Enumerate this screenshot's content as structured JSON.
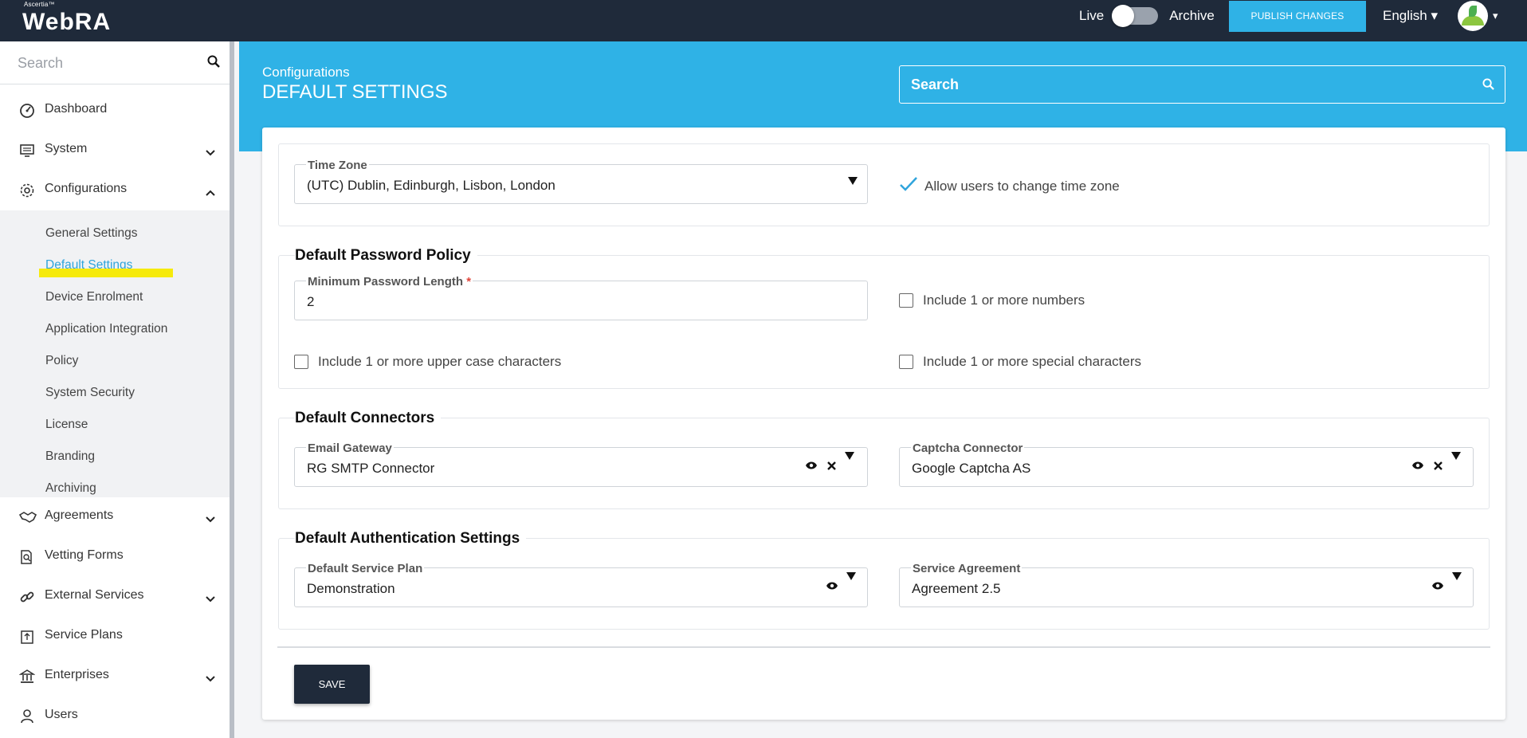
{
  "topbar": {
    "brand_small": "Ascertia™",
    "brand_name": "WebRA",
    "live_label": "Live",
    "archive_label": "Archive",
    "publish_label": "PUBLISH CHANGES",
    "language": "English ▾",
    "avatar_caret": "▾",
    "colors": {
      "bar": "#1f2a3a",
      "accent": "#2fb2e6"
    }
  },
  "sidebar": {
    "search_placeholder": "Search",
    "items": [
      {
        "label": "Dashboard",
        "icon": "dashboard-icon"
      },
      {
        "label": "System",
        "icon": "monitor-icon"
      },
      {
        "label": "Configurations",
        "icon": "gear-icon"
      },
      {
        "label": "Agreements",
        "icon": "handshake-icon"
      },
      {
        "label": "Vetting Forms",
        "icon": "form-search-icon"
      },
      {
        "label": "External Services",
        "icon": "link-icon"
      },
      {
        "label": "Service Plans",
        "icon": "plan-icon"
      },
      {
        "label": "Enterprises",
        "icon": "bank-icon"
      },
      {
        "label": "Users",
        "icon": "user-icon"
      }
    ],
    "subitems": [
      {
        "label": "General Settings"
      },
      {
        "label": "Default Settings"
      },
      {
        "label": "Device Enrolment"
      },
      {
        "label": "Application Integration"
      },
      {
        "label": "Policy"
      },
      {
        "label": "System Security"
      },
      {
        "label": "License"
      },
      {
        "label": "Branding"
      },
      {
        "label": "Archiving"
      }
    ]
  },
  "header": {
    "breadcrumb": "Configurations",
    "title": "DEFAULT SETTINGS",
    "search_placeholder": "Search"
  },
  "timezone": {
    "label": "Time Zone",
    "value": "(UTC) Dublin, Edinburgh, Lisbon, London",
    "allow_change_label": "Allow users to change time zone",
    "allow_change_checked": true
  },
  "password_policy": {
    "title": "Default Password Policy",
    "min_length_label": "Minimum Password Length",
    "min_length_required": "*",
    "min_length_value": "2",
    "numbers_label": "Include 1 or more numbers",
    "upper_label": "Include 1 or more upper case characters",
    "special_label": "Include 1 or more special characters"
  },
  "connectors": {
    "title": "Default Connectors",
    "email_label": "Email Gateway",
    "email_value": "RG SMTP Connector",
    "captcha_label": "Captcha Connector",
    "captcha_value": "Google Captcha AS"
  },
  "auth": {
    "title": "Default Authentication Settings",
    "plan_label": "Default Service Plan",
    "plan_value": "Demonstration",
    "agreement_label": "Service Agreement",
    "agreement_value": "Agreement 2.5"
  },
  "actions": {
    "save_label": "SAVE"
  }
}
